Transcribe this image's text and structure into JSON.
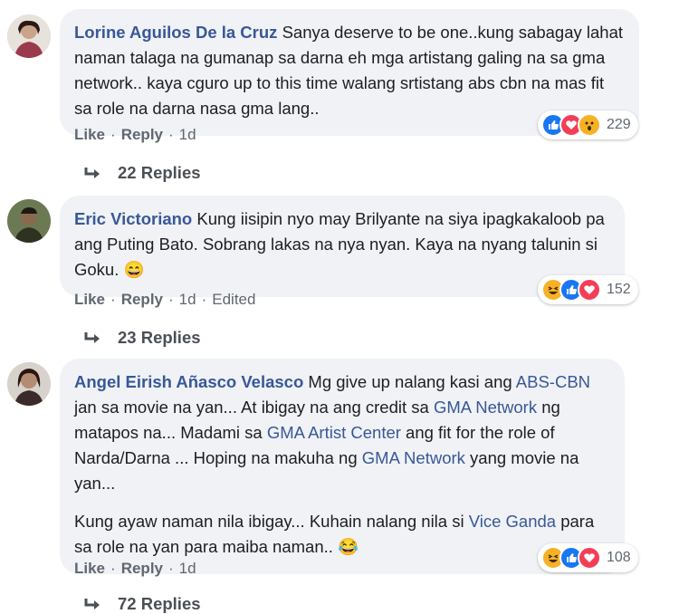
{
  "comments": [
    {
      "author": "Lorine Aguilos De la Cruz",
      "text": "Sanya deserve to be one..kung sabagay lahat naman talaga na gumanap sa darna eh mga artistang galing na sa gma network.. kaya cguro up to this time walang srtistang abs cbn na mas fit sa role na darna nasa gma lang..",
      "actions": {
        "like": "Like",
        "reply": "Reply",
        "time": "1d"
      },
      "reactions": {
        "icons": [
          "like-icon",
          "love-icon",
          "wow-icon"
        ],
        "count": "229"
      },
      "replies": "22 Replies"
    },
    {
      "author": "Eric Victoriano",
      "text": "Kung iisipin nyo may Brilyante na siya ipagkakaloob pa ang Puting Bato. Sobrang lakas na nya nyan. Kaya na nyang talunin si Goku.",
      "emoji": "😄",
      "actions": {
        "like": "Like",
        "reply": "Reply",
        "time": "1d",
        "edited": "Edited"
      },
      "reactions": {
        "icons": [
          "haha-icon",
          "like-icon",
          "love-icon"
        ],
        "count": "152"
      },
      "replies": "23 Replies"
    },
    {
      "author": "Angel Eirish Añasco Velasco",
      "p1": [
        "Mg give up nalang kasi ang ",
        "ABS-CBN",
        " jan sa movie na yan... At ibigay na ang credit sa ",
        "GMA Network",
        " ng matapos na... Madami sa ",
        "GMA Artist Center",
        " ang fit for the role of Narda/Darna ... Hoping na makuha ng ",
        "GMA Network",
        " yang movie na yan..."
      ],
      "p2": [
        "Kung ayaw naman nila ibigay... Kuhain nalang nila si ",
        "Vice Ganda",
        " para sa role na yan para maiba naman.."
      ],
      "emoji": "😂",
      "actions": {
        "like": "Like",
        "reply": "Reply",
        "time": "1d"
      },
      "reactions": {
        "icons": [
          "haha-icon",
          "like-icon",
          "love-icon"
        ],
        "count": "108"
      },
      "replies": "72 Replies"
    }
  ],
  "colors": {
    "link": "#385898",
    "bubble": "#f0f2f5",
    "like": "#1877f2",
    "love": "#f33e58",
    "haha": "#f7b125"
  }
}
